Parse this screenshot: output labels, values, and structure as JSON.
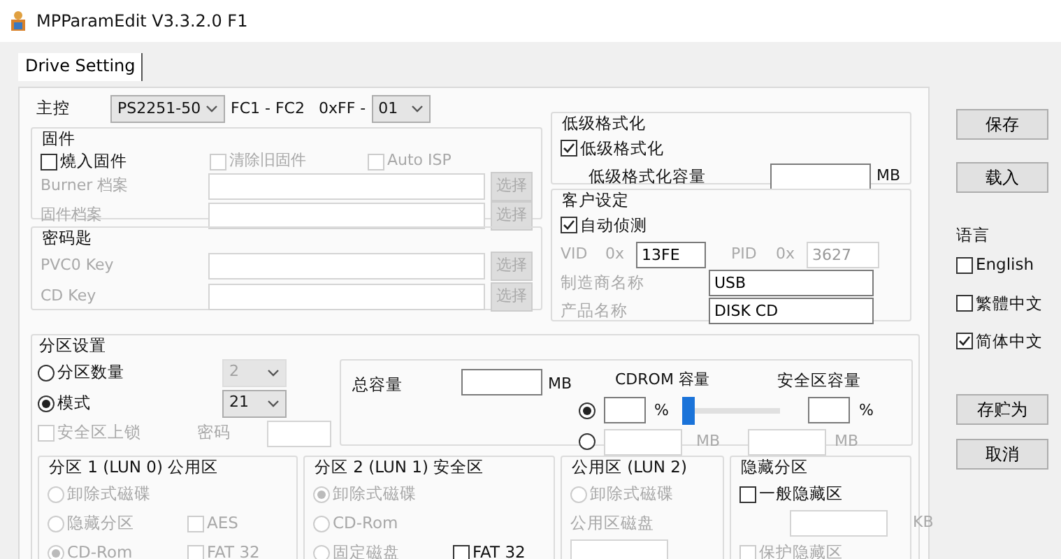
{
  "window": {
    "title": "MPParamEdit V3.3.2.0 F1"
  },
  "tabs": [
    {
      "label": "Drive Setting",
      "selected": true
    }
  ],
  "controller": {
    "label": "主控",
    "value": "PS2251-50",
    "range_label": "FC1 - FC2",
    "hex_label": "0xFF -",
    "hex_value": "01"
  },
  "firmware": {
    "title": "固件",
    "burn": {
      "label": "燒入固件",
      "checked": false
    },
    "options": [
      {
        "label": "清除旧固件",
        "checked": false,
        "disabled": true
      },
      {
        "label": "Auto ISP",
        "checked": false,
        "disabled": true
      }
    ],
    "files": [
      {
        "label": "Burner 档案",
        "button": "选择"
      },
      {
        "label": "固件档案",
        "button": "选择"
      }
    ]
  },
  "key_group": {
    "title": "密码匙",
    "files": [
      {
        "label": "PVC0 Key",
        "button": "选择"
      },
      {
        "label": "CD Key",
        "button": "选择"
      }
    ]
  },
  "low_format": {
    "title": "低级格式化",
    "enable": {
      "label": "低级格式化",
      "checked": true
    },
    "capacity_label": "低级格式化容量",
    "unit": "MB"
  },
  "customer": {
    "title": "客户设定",
    "auto_detect": {
      "label": "自动侦测",
      "checked": true
    },
    "vid_label": "VID",
    "vid_prefix": "0x",
    "vid": "13FE",
    "pid_label": "PID",
    "pid_prefix": "0x",
    "pid": "3627",
    "fields": [
      {
        "label": "制造商名称",
        "value": "USB"
      },
      {
        "label": "产品名称",
        "value": "DISK CD"
      }
    ]
  },
  "partition": {
    "title": "分区设置",
    "modes": [
      {
        "label": "分区数量",
        "selected": false,
        "value": "2",
        "disabled": true
      },
      {
        "label": "模式",
        "selected": true,
        "value": "21",
        "disabled": false
      }
    ],
    "lock": {
      "label": "安全区上锁",
      "checked": false
    },
    "password_label": "密码",
    "total_label": "总容量",
    "total_unit": "MB",
    "cdrom_label": "CDROM 容量",
    "secure_label": "安全区容量",
    "size_modes": [
      {
        "selected": true,
        "unit": "%",
        "secure_unit": "%"
      },
      {
        "selected": false,
        "unit": "MB",
        "secure_unit": "MB"
      }
    ],
    "slider": {
      "level": 0
    },
    "sections": [
      {
        "title": "分区 1 (LUN 0) 公用区",
        "rows": [
          [
            {
              "kind": "radio",
              "label": "卸除式磁碟",
              "selected": false,
              "disabled": true
            }
          ],
          [
            {
              "kind": "radio",
              "label": "隐藏分区",
              "selected": false,
              "disabled": true
            },
            {
              "kind": "checkbox",
              "label": "AES",
              "checked": false,
              "disabled": true
            }
          ],
          [
            {
              "kind": "radio",
              "label": "CD-Rom",
              "selected": true,
              "disabled": true
            },
            {
              "kind": "checkbox",
              "label": "FAT 32",
              "checked": false,
              "disabled": true
            }
          ]
        ]
      },
      {
        "title": "分区 2 (LUN 1) 安全区",
        "rows": [
          [
            {
              "kind": "radio",
              "label": "卸除式磁碟",
              "selected": true,
              "disabled": true
            }
          ],
          [
            {
              "kind": "radio",
              "label": "CD-Rom",
              "selected": false,
              "disabled": true
            }
          ],
          [
            {
              "kind": "radio",
              "label": "固定磁盘",
              "selected": false,
              "disabled": true
            },
            {
              "kind": "checkbox",
              "label": "FAT 32",
              "checked": false,
              "disabled": false
            }
          ]
        ]
      },
      {
        "title": "公用区 (LUN 2)",
        "rows": [
          [
            {
              "kind": "radio",
              "label": "卸除式磁碟",
              "selected": false,
              "disabled": true
            }
          ],
          [
            {
              "kind": "label",
              "label": "公用区磁盘",
              "disabled": true
            }
          ],
          [
            {
              "kind": "field",
              "disabled": true
            }
          ]
        ]
      },
      {
        "title": "隐藏分区",
        "rows": [
          [
            {
              "kind": "checkbox",
              "label": "一般隐藏区",
              "checked": false,
              "disabled": false
            }
          ],
          [
            {
              "kind": "field",
              "unit": "KB",
              "disabled": true
            }
          ],
          [
            {
              "kind": "checkbox",
              "label": "保护隐藏区",
              "checked": false,
              "disabled": true
            }
          ]
        ]
      }
    ]
  },
  "side_buttons": [
    "保存",
    "载入"
  ],
  "language": {
    "title": "语言",
    "options": [
      {
        "label": "English",
        "checked": false
      },
      {
        "label": "繁體中文",
        "checked": false
      },
      {
        "label": "简体中文",
        "checked": true
      }
    ]
  },
  "lower_buttons": [
    "存贮为",
    "取消"
  ]
}
